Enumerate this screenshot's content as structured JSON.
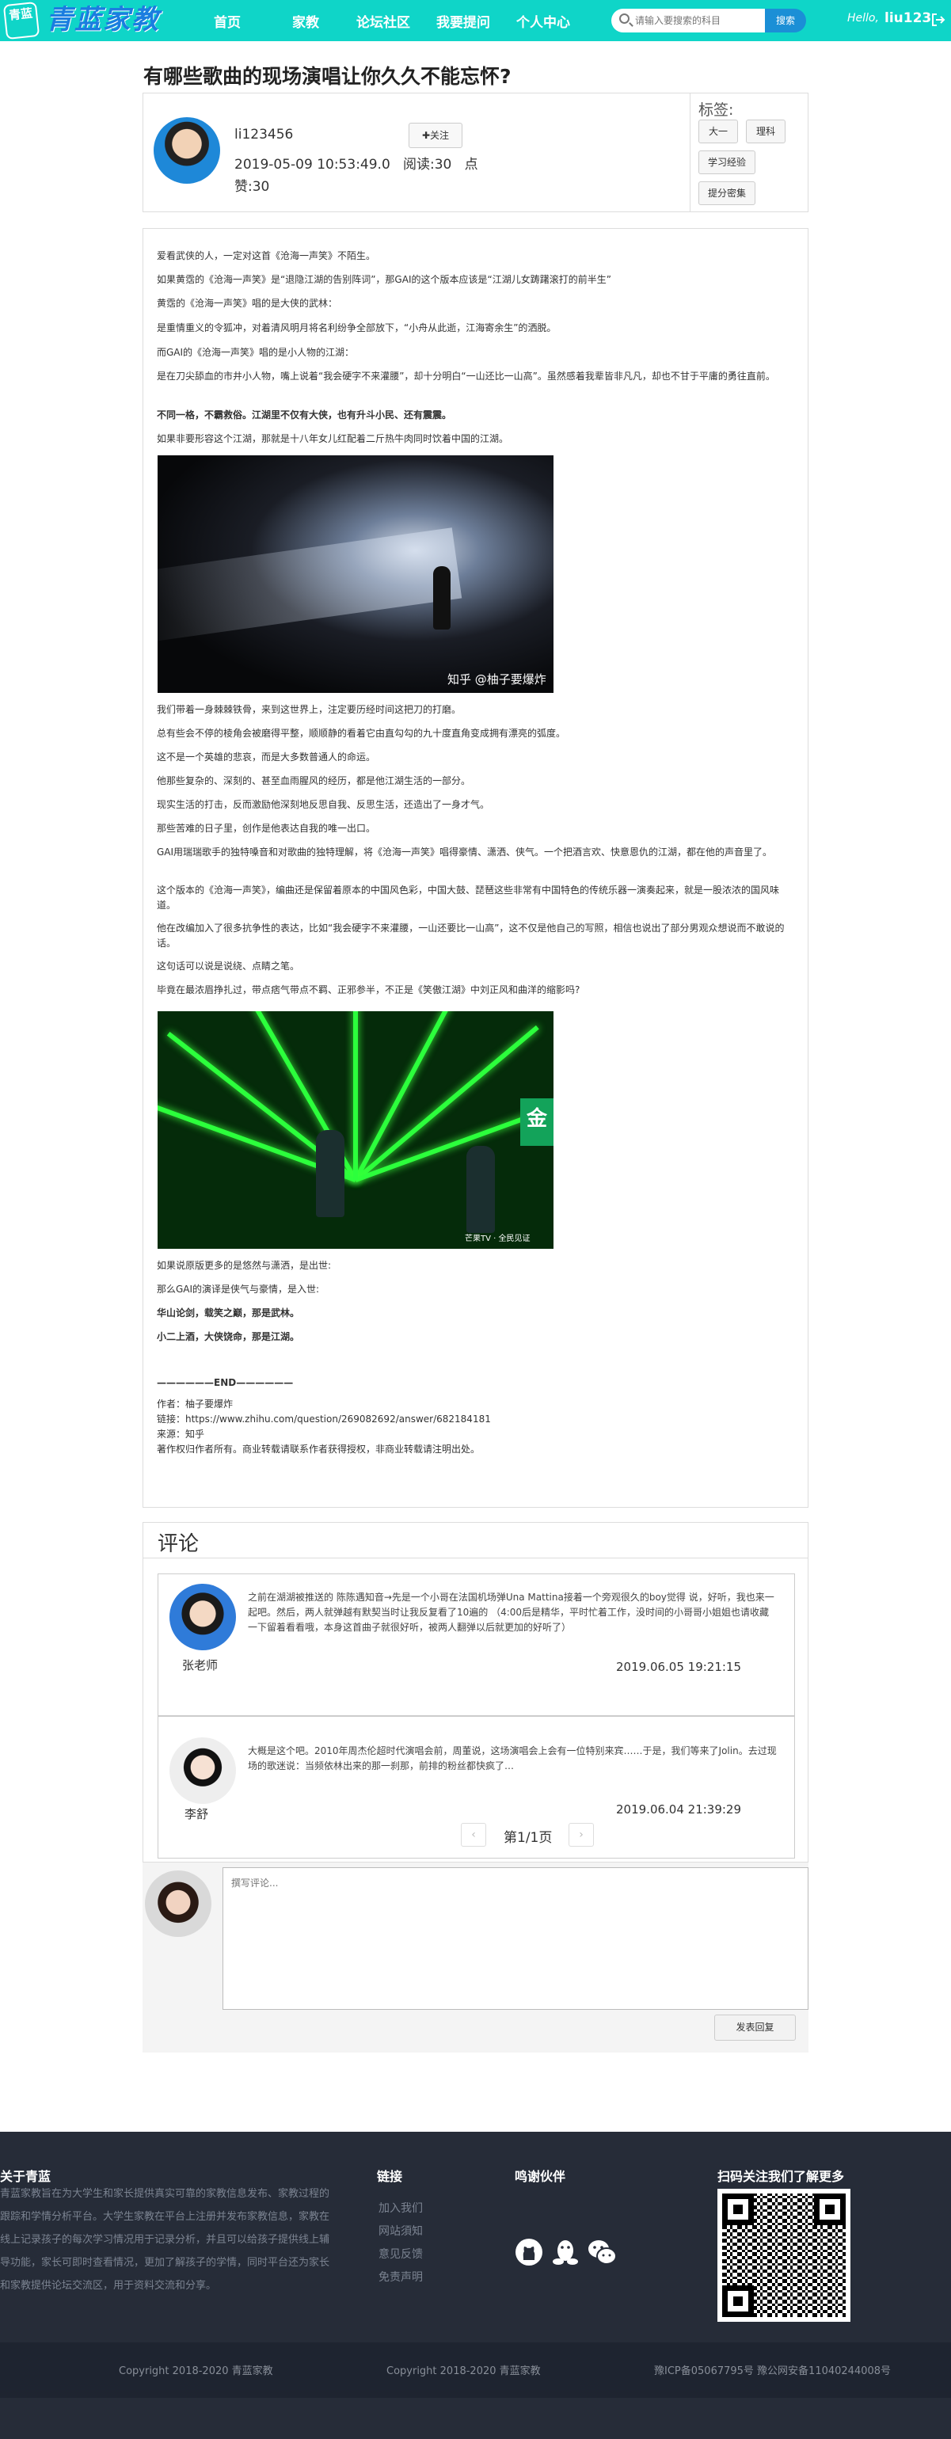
{
  "nav": {
    "logo_badge": "青蓝",
    "logo_text": "青蓝家教",
    "links": [
      "首页",
      "家教",
      "论坛社区",
      "我要提问",
      "个人中心"
    ],
    "search_placeholder": "请输入要搜索的科目",
    "search_button": "搜索",
    "hello": "Hello,",
    "username": "liu123",
    "icons": {
      "search": "search-icon",
      "logout": "logout-icon"
    },
    "colors": {
      "bar": "#0fd5c8",
      "search_button": "#1b8fd6",
      "logo": "#1b7de0"
    }
  },
  "article": {
    "title": "有哪些歌曲的现场演唱让你久久不能忘怀?",
    "author": "li123456",
    "follow_label": "关注",
    "date": "2019-05-09 10:53:49.0",
    "reads": "阅读:30",
    "likes_label": "点",
    "likes": "赞:30",
    "tags_title": "标签:",
    "tags": [
      "大一",
      "理科",
      "学习经验",
      "提分密集"
    ],
    "paragraphs": [
      "爱看武侠的人，一定对这首《沧海一声笑》不陌生。",
      "如果黄霑的《沧海一声笑》是“退隐江湖的告别阵词”，那GAI的这个版本应该是“江湖儿女踌躇滚打的前半生”",
      "黄霑的《沧海一声笑》唱的是大侠的武林：",
      "是重情重义的令狐冲，对着清风明月将名利纷争全部放下，“小舟从此逝，江海寄余生”的洒脱。",
      "而GAI的《沧海一声笑》唱的是小人物的江湖：",
      "是在刀尖舔血的市井小人物，嘴上说着“我会硬字不来灌腰”，却十分明白“一山还比一山高”。虽然感着我辈皆非凡凡，却也不甘于平庸的勇往直前。",
      "不同一格，不霸救俗。江湖里不仅有大侠，也有升斗小民、还有震震。",
      "如果非要形容这个江湖，那就是十八年女儿红配着二斤热牛肉同时饮着中国的江湖。",
      "我们带着一身棘棘铁骨，来到这世界上，注定要历经时间这把刀的打磨。",
      "总有些会不停的棱角会被磨得平整，顺顺静的看着它由直勾勾的九十度直角变成拥有漂亮的弧度。",
      "这不是一个英雄的悲哀，而是大多数普通人的命运。",
      "他那些复杂的、深刻的、甚至血雨腥风的经历，都是他江湖生活的一部分。",
      "现实生活的打击，反而激励他深刻地反思自我、反思生活，还造出了一身才气。",
      "那些苦难的日子里，创作是他表达自我的唯一出口。",
      "GAI用瑞瑞歌手的独特嗓音和对歌曲的独特理解，将《沧海一声笑》唱得豪情、潇洒、侠气。一个把酒言欢、快意恩仇的江湖，都在他的声音里了。",
      "这个版本的《沧海一声笑》，编曲还是保留着原本的中国风色彩，中国大鼓、琵琶这些非常有中国特色的传统乐器一演奏起来，就是一股浓浓的国风味道。",
      "他在改编加入了很多抗争性的表达，比如“我会硬字不来灌腰，一山还要比一山高”，这不仅是他自己的写照，相信也说出了部分男观众想说而不敢说的话。",
      "这句话可以说是说绕、点睛之笔。",
      "毕竟在最浓眉挣扎过，带点痞气带点不羁、正邪参半，不正是《笑傲江湖》中刘正风和曲洋的缩影吗?",
      "如果说原版更多的是悠然与潇洒，是出世:",
      "那么GAI的演译是侠气与豪情，是入世:",
      "华山论剑，载笑之巅，那是武林。",
      "小二上酒，大侠饶命，那是江湖。",
      "——————END——————",
      "作者：柚子要爆炸",
      "链接：https://www.zhihu.com/question/269082692/answer/682184181",
      "来源：知乎",
      "著作权归作者所有。商业转载请联系作者获得授权，非商业转载请注明出处。"
    ],
    "image1_caption": "知乎 @柚子要爆炸",
    "image2_caption": "芒果TV · 全民见证"
  },
  "comments": {
    "title": "评论",
    "items": [
      {
        "name": "张老师",
        "text": "之前在湖湖被推送的 陈陈遇知音→先是一个小哥在法国机场弹Una Mattina接着一个旁观很久的boy觉得 说，好听，我也来一起吧。然后，两人就弹越有默契当时让我反复看了10遍的 （4:00后是精华，平时忙着工作，没时间的小哥哥小姐姐也请收藏一下留着看看哦，本身这首曲子就很好听，被两人翻弹以后就更加的好听了）",
        "date": "2019.06.05 19:21:15"
      },
      {
        "name": "李舒",
        "text": "大概是这个吧。2010年周杰伦超时代演唱会前，周董说，这场演唱会上会有一位特别来宾……于是，我们等来了Jolin。去过现场的歌迷说：当频依林出来的那一刹那，前排的粉丝都快疯了…",
        "date": "2019.06.04 21:39:29"
      }
    ],
    "prev": "‹",
    "next": "›",
    "page_info": "第1/1页"
  },
  "reply": {
    "placeholder": "撰写评论...",
    "submit_label": "发表回复"
  },
  "footer": {
    "about_title": "关于青蓝",
    "about_text": "青蓝家教旨在为大学生和家长提供真实可靠的家教信息发布、家教过程的跟踪和学情分析平台。大学生家教在平台上注册并发布家教信息，家教在线上记录孩子的每次学习情况用于记录分析，并且可以给孩子提供线上辅导功能，家长可即时查看情况，更加了解孩子的学情，同时平台还为家长和家教提供论坛交流区，用于资料交流和分享。",
    "links_title": "链接",
    "links": [
      "加入我们",
      "网站須知",
      "意见反馈",
      "免责声明"
    ],
    "thanks_title": "鸣谢伙伴",
    "partner_icons": [
      "github-icon",
      "qq-icon",
      "wechat-icon"
    ],
    "qr_title": "扫码关注我们了解更多",
    "copyright_1": "Copyright 2018-2020   青蓝家教",
    "copyright_2": "Copyright 2018-2020   青蓝家教",
    "icp": "豫ICP备05067795号 豫公网安备11040244008号"
  }
}
